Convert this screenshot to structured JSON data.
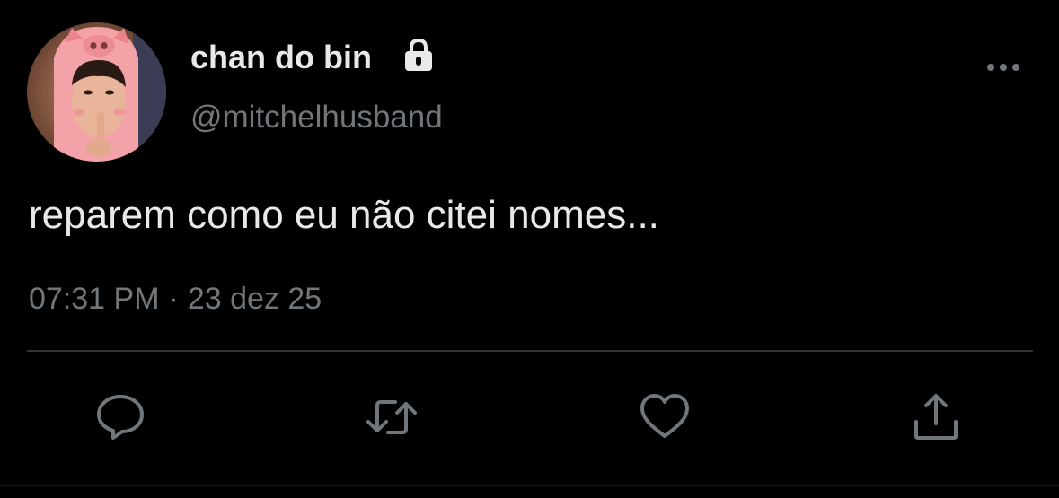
{
  "colors": {
    "background": "#000000",
    "primary_text": "#e7e9ea",
    "secondary_text": "#71767b",
    "divider": "#2f3336"
  },
  "user": {
    "display_name": "chan do bin",
    "handle": "@mitchelhusband",
    "protected_icon": "lock-icon",
    "avatar": "pig-costume-avatar"
  },
  "tweet": {
    "text": "reparem como eu não citei nomes...",
    "time": "07:31 PM",
    "separator": "·",
    "date": "23 dez 25"
  },
  "actions": [
    {
      "name": "reply",
      "icon": "reply-icon"
    },
    {
      "name": "retweet",
      "icon": "retweet-icon"
    },
    {
      "name": "like",
      "icon": "heart-icon"
    },
    {
      "name": "share",
      "icon": "share-icon"
    }
  ],
  "menu_icon": "more-options-icon"
}
